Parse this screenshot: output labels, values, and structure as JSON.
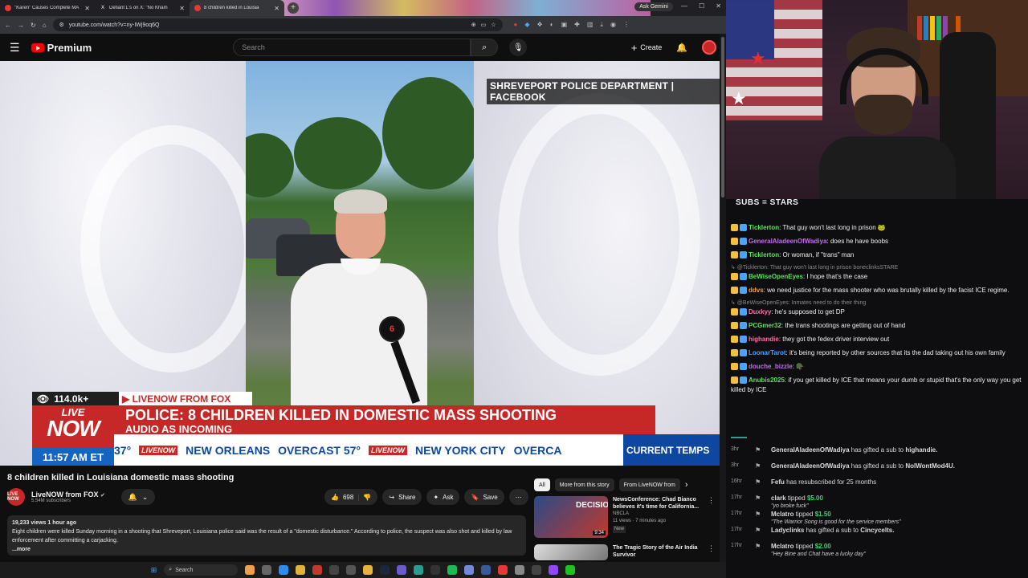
{
  "browser": {
    "tabs": [
      {
        "title": "\"Karen\" Causes Complete MA",
        "fav": "#e53935"
      },
      {
        "title": "Defiant L's on X: \"No Kham",
        "fav": "#222"
      },
      {
        "title": "8 children killed in Louisia",
        "fav": "#e53935"
      }
    ],
    "new_tab": "+",
    "ask_gemini": "Ask Gemini",
    "url": "youtube.com/watch?v=ny-IWj9oq6Q"
  },
  "youtube": {
    "logo_text": "Premium",
    "search_placeholder": "Search",
    "create_label": "Create"
  },
  "video": {
    "credit": "SHREVEPORT POLICE DEPARTMENT | FACEBOOK",
    "viewers": "114.0k+",
    "livenow_from": "▶ LIVENOW FROM FOX",
    "live_word": "LIVE",
    "now_word": "NOW",
    "headline": "POLICE: 8 CHILDREN KILLED IN DOMESTIC MASS SHOOTING",
    "subheadline": "AUDIO AS INCOMING",
    "time": "11:57 AM ET",
    "ticker": [
      "37°",
      "NEW ORLEANS",
      "OVERCAST 57°",
      "NEW YORK CITY",
      "OVERCA"
    ],
    "ticker_chip": "LIVENOW",
    "temps_label": "CURRENT TEMPS",
    "mic_flag": "6"
  },
  "meta": {
    "title": "8 children killed in Louisiana domestic mass shooting",
    "channel": "LiveNOW from FOX",
    "channel_avatar": "LIVE NOW",
    "subs": "5.54M subscribers",
    "likes": "698",
    "share": "Share",
    "ask": "Ask",
    "save": "Save",
    "desc_stats": "19,233 views  1 hour ago",
    "desc_text": "Eight children were killed Sunday morning in a shooting that Shreveport, Louisiana police said was the result of a \"domestic disturbance.\" According to police, the suspect was also shot and killed by law enforcement after committing a carjacking.",
    "more": "...more"
  },
  "sidebar": {
    "chips": [
      "All",
      "More from this story",
      "From LiveNOW from"
    ],
    "recs": [
      {
        "title": "NewsConference: Chad Bianco believes it's time for California...",
        "channel": "NBCLA",
        "meta": "11 views · 7 minutes ago",
        "badge": "New",
        "duration": "9:34"
      },
      {
        "title": "The Tragic Story of the Air India Survivor",
        "channel": "",
        "meta": "",
        "badge": "",
        "duration": ""
      }
    ]
  },
  "chat": {
    "banner": "SUBS = STARS",
    "messages": [
      {
        "reply": "",
        "user": "Ticklerton",
        "color": "#5ee05e",
        "text": "That guy won't last long in prison 🐸"
      },
      {
        "reply": "",
        "user": "GeneralAladeenOfWadiya",
        "color": "#c36cf0",
        "text": "does he have boobs"
      },
      {
        "reply": "",
        "user": "Ticklerton",
        "color": "#5ee05e",
        "text": "Or woman, if \"trans\" man"
      },
      {
        "reply": "@Ticklerton: That guy won't last long in prison boneclinksSTARE",
        "user": "BeWiseOpenEyes",
        "color": "#5ee05e",
        "text": "I hope that's the case"
      },
      {
        "reply": "",
        "user": "ddvs",
        "color": "#f0a04a",
        "text": "we need justice for the mass shooter who was brutally killed by the facist ICE regime."
      },
      {
        "reply": "@BeWiseOpenEyes: Inmates need to do their thing",
        "user": "Duxkyy",
        "color": "#ff6fa8",
        "text": "he's supposed to get DP"
      },
      {
        "reply": "",
        "user": "PCGmer32",
        "color": "#5ee05e",
        "text": "the trans shootings are getting out of hand"
      },
      {
        "reply": "",
        "user": "highandie",
        "color": "#ff6fa8",
        "text": "they got the fedex driver interview out"
      },
      {
        "reply": "",
        "user": "LoonarTarot",
        "color": "#4aa3ff",
        "text": "it's being reported by other sources that its the dad taking out his own family"
      },
      {
        "reply": "",
        "user": "douche_bizzle",
        "color": "#c36cf0",
        "text": "🪖"
      },
      {
        "reply": "",
        "user": "Anubis2025",
        "color": "#5ee05e",
        "text": "if you get killed by ICE that means your dumb or stupid that's the only way you get killed by ICE"
      }
    ]
  },
  "events": [
    {
      "age": "3hr",
      "text_a": "GeneralAladeenOfWadiya",
      "text_b": " has gifted a sub to ",
      "text_c": "highandie.",
      "amount": "",
      "quote": ""
    },
    {
      "age": "3hr",
      "text_a": "GeneralAladeenOfWadiya",
      "text_b": " has gifted a sub to ",
      "text_c": "NolWontMod4U.",
      "amount": "",
      "quote": ""
    },
    {
      "age": "16hr",
      "text_a": "Fefu",
      "text_b": " has resubscribed for 25 months",
      "text_c": "",
      "amount": "",
      "quote": ""
    },
    {
      "age": "17hr",
      "text_a": "clark",
      "text_b": " tipped ",
      "text_c": "",
      "amount": "$5.00",
      "quote": "\"yo broke fuck\""
    },
    {
      "age": "17hr",
      "text_a": "Mclatro",
      "text_b": " tipped ",
      "text_c": "",
      "amount": "$1.50",
      "quote": "\"The Warrior Song is good for the service members\""
    },
    {
      "age": "17hr",
      "text_a": "Ladyclinks",
      "text_b": " has gifted a sub to ",
      "text_c": "Cincycelts.",
      "amount": "",
      "quote": ""
    },
    {
      "age": "17hr",
      "text_a": "Mclatro",
      "text_b": " tipped ",
      "text_c": "",
      "amount": "$2.00",
      "quote": "\"Hey Bine and Chat have a lucky day\""
    }
  ],
  "taskbar": {
    "search": "Search"
  }
}
